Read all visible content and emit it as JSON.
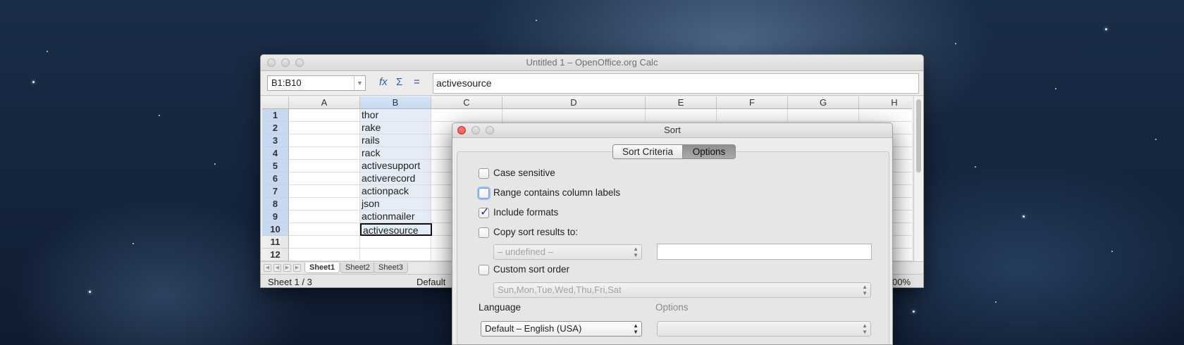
{
  "calc": {
    "title": "Untitled 1 – OpenOffice.org Calc",
    "name_box": "B1:B10",
    "formula_icons": [
      "function-wizard-icon",
      "sum-icon",
      "equals-icon"
    ],
    "formula_value": "activesource",
    "columns": [
      "A",
      "B",
      "C",
      "D",
      "E",
      "F",
      "G",
      "H"
    ],
    "selected_column": "B",
    "rows": [
      "1",
      "2",
      "3",
      "4",
      "5",
      "6",
      "7",
      "8",
      "9",
      "10",
      "11",
      "12"
    ],
    "column_b_values": [
      "thor",
      "rake",
      "rails",
      "rack",
      "activesupport",
      "activerecord",
      "actionpack",
      "json",
      "actionmailer",
      "activesource"
    ],
    "sheet_tabs": [
      "Sheet1",
      "Sheet2",
      "Sheet3"
    ],
    "active_sheet": "Sheet1",
    "status": {
      "sheet_info": "Sheet 1 / 3",
      "page_style": "Default",
      "zoom": "00%"
    }
  },
  "sort_dialog": {
    "title": "Sort",
    "tabs": [
      "Sort Criteria",
      "Options"
    ],
    "active_tab": "Options",
    "options": {
      "case_sensitive": {
        "label": "Case sensitive",
        "checked": false
      },
      "range_labels": {
        "label": "Range contains column labels",
        "checked": false
      },
      "include_formats": {
        "label": "Include formats",
        "checked": true
      },
      "copy_results": {
        "label": "Copy sort results to:",
        "checked": false
      },
      "copy_target_select": "– undefined –",
      "custom_order": {
        "label": "Custom sort order",
        "checked": false
      },
      "custom_order_select": "Sun,Mon,Tue,Wed,Thu,Fri,Sat",
      "language_label": "Language",
      "language_select": "Default – English (USA)",
      "options_label": "Options",
      "options_select": ""
    }
  }
}
